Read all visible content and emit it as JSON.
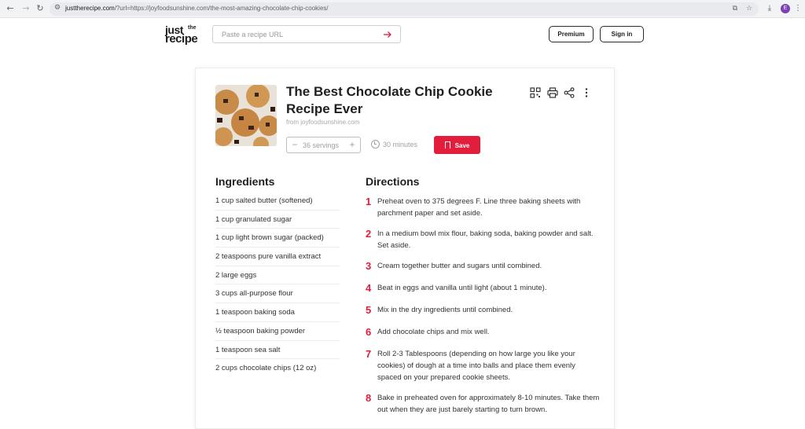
{
  "browser": {
    "url_domain": "justtherecipe.com",
    "url_rest": "/?url=https://joyfoodsunshine.com/the-most-amazing-chocolate-chip-cookies/",
    "profile_initial": "E"
  },
  "header": {
    "logo_just": "just",
    "logo_the": "the",
    "logo_recipe": "recipe",
    "search_placeholder": "Paste a recipe URL",
    "search_value": "",
    "premium_label": "Premium",
    "signin_label": "Sign in"
  },
  "recipe": {
    "title": "The Best Chocolate Chip Cookie Recipe Ever",
    "source": "from joyfoodsunshine.com",
    "servings_count": "36",
    "servings_label": "servings",
    "time": "30 minutes",
    "save_label": "Save",
    "ingredients_heading": "Ingredients",
    "directions_heading": "Directions",
    "ingredients": [
      "1 cup salted butter (softened)",
      "1 cup granulated sugar",
      "1 cup light brown sugar (packed)",
      "2 teaspoons pure vanilla extract",
      "2 large eggs",
      "3 cups all-purpose flour",
      "1 teaspoon baking soda",
      "½ teaspoon baking powder",
      "1 teaspoon sea salt",
      "2 cups chocolate chips (12 oz)"
    ],
    "directions": [
      {
        "num": "1",
        "text": "Preheat oven to 375 degrees F. Line three baking sheets with parchment paper and set aside."
      },
      {
        "num": "2",
        "text": "In a medium bowl mix flour, baking soda, baking powder and salt. Set aside."
      },
      {
        "num": "3",
        "text": "Cream together butter and sugars until combined."
      },
      {
        "num": "4",
        "text": "Beat in eggs and vanilla until light (about 1 minute)."
      },
      {
        "num": "5",
        "text": "Mix in the dry ingredients until combined."
      },
      {
        "num": "6",
        "text": "Add chocolate chips and mix well."
      },
      {
        "num": "7",
        "text": "Roll 2-3 Tablespoons (depending on how large you like your cookies) of dough at a time into balls and place them evenly spaced on your prepared cookie sheets."
      },
      {
        "num": "8",
        "text": "Bake in preheated oven for approximately 8-10 minutes. Take them out when they are just barely starting to turn brown."
      }
    ]
  },
  "colors": {
    "accent": "#e31d3c",
    "chrome": "#f1f3f4"
  }
}
